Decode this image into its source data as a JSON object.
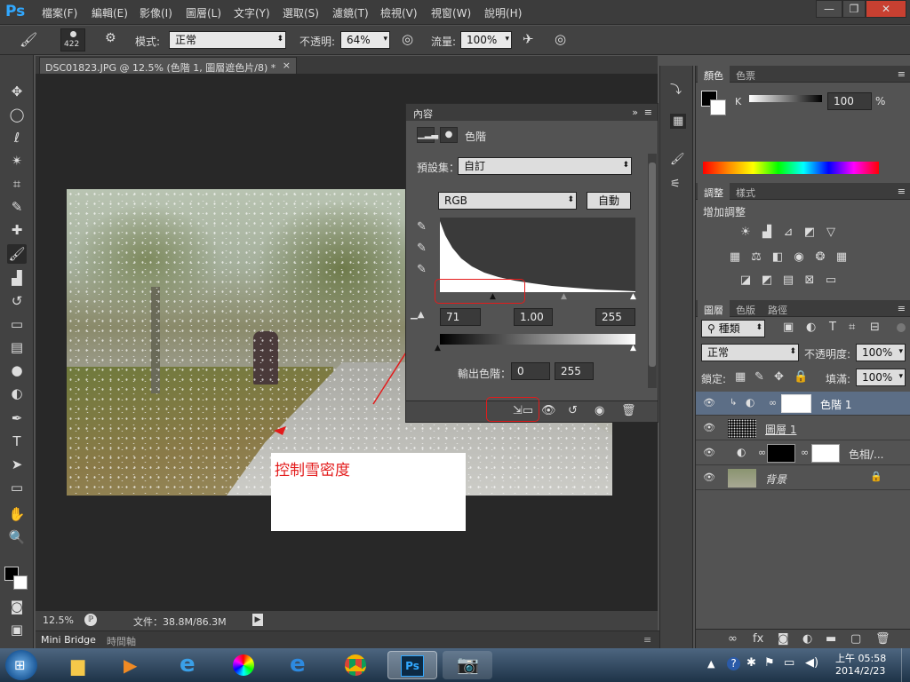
{
  "app": {
    "logo": "Ps"
  },
  "menu": [
    "檔案(F)",
    "編輯(E)",
    "影像(I)",
    "圖層(L)",
    "文字(Y)",
    "選取(S)",
    "濾鏡(T)",
    "檢視(V)",
    "視窗(W)",
    "說明(H)"
  ],
  "window_controls": {
    "minimize": "—",
    "restore": "❐",
    "close": "✕"
  },
  "options": {
    "brush_size": "422",
    "mode_label": "模式:",
    "mode_value": "正常",
    "opacity_label": "不透明:",
    "opacity_value": "64%",
    "flow_label": "流量:",
    "flow_value": "100%"
  },
  "document": {
    "tab_title": "DSC01823.JPG @ 12.5% (色階 1, 圖層遮色片/8) *",
    "tab_close": "×",
    "zoom": "12.5%",
    "file_info": "文件：38.8M/86.3M"
  },
  "annotation": {
    "text": "控制雪密度",
    "color": "#e31b1b"
  },
  "bottom_tabs": {
    "mini_bridge": "Mini Bridge",
    "timeline": "時間軸"
  },
  "properties": {
    "tab": "內容",
    "title": "色階",
    "preset_label": "預設集：",
    "preset_value": "自訂",
    "channel": "RGB",
    "auto_button": "自動",
    "input_black": "71",
    "input_gamma": "1.00",
    "input_white": "255",
    "output_label": "輸出色階：",
    "output_black": "0",
    "output_white": "255"
  },
  "color_panel": {
    "tabs": [
      "顏色",
      "色票"
    ],
    "channel": "K",
    "value": "100",
    "unit": "%"
  },
  "adjustments": {
    "tabs": [
      "調整",
      "樣式"
    ],
    "title": "增加調整"
  },
  "layers_panel": {
    "tabs": [
      "圖層",
      "色版",
      "路徑"
    ],
    "filter": "種類",
    "blend_mode": "正常",
    "opacity_label": "不透明度:",
    "opacity_value": "100%",
    "lock_label": "鎖定:",
    "fill_label": "填滿:",
    "fill_value": "100%",
    "layers": [
      {
        "name": "色階 1",
        "selected": true
      },
      {
        "name": "圖層 1",
        "selected": false
      },
      {
        "name": "色相/...",
        "selected": false
      },
      {
        "name": "背景",
        "selected": false
      }
    ]
  },
  "taskbar": {
    "clock_time": "上午 05:58",
    "clock_date": "2014/2/23"
  },
  "colors": {
    "accent_red": "#e31b1b",
    "ps_blue": "#31a8ff",
    "selected_layer": "#5c6e86"
  }
}
